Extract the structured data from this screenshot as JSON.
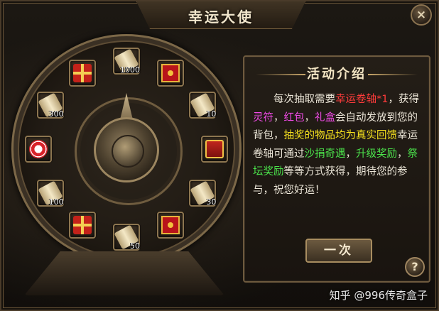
{
  "window": {
    "title": "幸运大使",
    "close_label": "×"
  },
  "wheel": {
    "slots": [
      {
        "name": "lucky-scroll",
        "icon": "scroll-icon",
        "count": "1000"
      },
      {
        "name": "red-envelope",
        "icon": "red-envelope-icon",
        "count": ""
      },
      {
        "name": "lucky-scroll",
        "icon": "scroll-icon",
        "count": "10"
      },
      {
        "name": "charm",
        "icon": "charm-icon",
        "count": ""
      },
      {
        "name": "lucky-scroll",
        "icon": "scroll-icon",
        "count": "30"
      },
      {
        "name": "red-envelope",
        "icon": "red-envelope-icon",
        "count": ""
      },
      {
        "name": "lucky-scroll",
        "icon": "scroll-icon",
        "count": "50"
      },
      {
        "name": "gift-box",
        "icon": "gift-box-icon",
        "count": ""
      },
      {
        "name": "lucky-scroll",
        "icon": "scroll-icon",
        "count": "100"
      },
      {
        "name": "poker-chips",
        "icon": "poker-chips-icon",
        "count": ""
      },
      {
        "name": "lucky-scroll",
        "icon": "scroll-icon",
        "count": "300"
      },
      {
        "name": "gift-box",
        "icon": "gift-box-icon",
        "count": ""
      }
    ]
  },
  "panel": {
    "title": "活动介绍",
    "desc": [
      {
        "t": "每次抽取需要",
        "c": ""
      },
      {
        "t": "幸运卷轴*1",
        "c": "red"
      },
      {
        "t": "，获得",
        "c": ""
      },
      {
        "t": "灵符",
        "c": "pink"
      },
      {
        "t": "，",
        "c": ""
      },
      {
        "t": "红包",
        "c": "pink"
      },
      {
        "t": "，",
        "c": ""
      },
      {
        "t": "礼盒",
        "c": "pink"
      },
      {
        "t": "会自动发放到您的背包，",
        "c": ""
      },
      {
        "t": "抽奖的物品均为真实回馈",
        "c": "yellow"
      },
      {
        "t": "幸运卷轴可通过",
        "c": ""
      },
      {
        "t": "沙捐奇遇",
        "c": "green"
      },
      {
        "t": "，",
        "c": ""
      },
      {
        "t": "升级奖励",
        "c": "green"
      },
      {
        "t": "，",
        "c": ""
      },
      {
        "t": "祭坛奖励",
        "c": "green"
      },
      {
        "t": "等等方式获得，期待您的参与，祝您好运！",
        "c": ""
      }
    ],
    "draw_button_label": "一次",
    "help_label": "?"
  },
  "watermark": "知乎 @996传奇盒子",
  "colors": {
    "red": "#ff3b3b",
    "pink": "#f24be8",
    "yellow": "#f7e21e",
    "green": "#4be24b"
  }
}
